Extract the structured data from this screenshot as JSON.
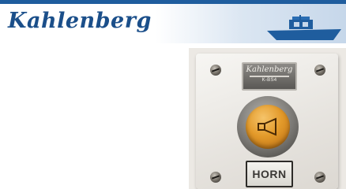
{
  "header": {
    "brand": "Kahlenberg",
    "boat_icon": "boat-icon"
  },
  "product": {
    "plate_brand": "Kahlenberg",
    "plate_subtext": "K-BS4",
    "button_icon": "horn-icon",
    "button_label": "HORN",
    "colors": {
      "button": "#e39a2a",
      "brand": "#1b4f8a"
    }
  }
}
